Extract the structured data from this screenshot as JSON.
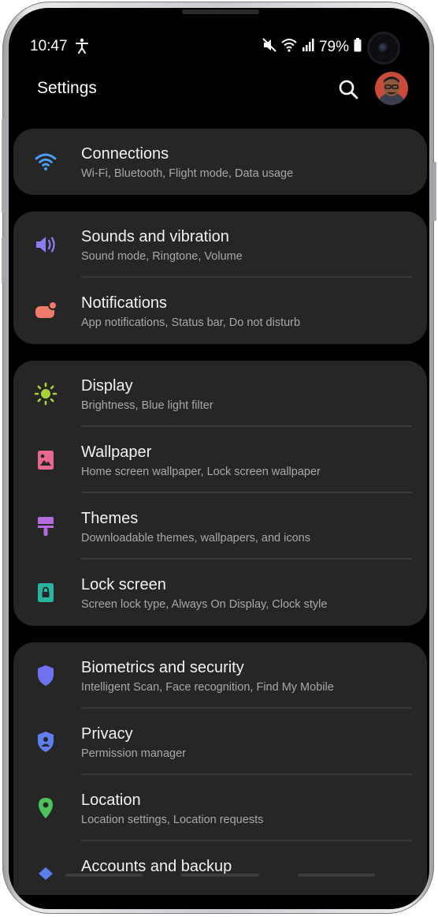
{
  "status_bar": {
    "time": "10:47",
    "battery": "79%",
    "icons": [
      "accessibility-icon",
      "mute-icon",
      "wifi-icon",
      "signal-icon",
      "battery-icon"
    ]
  },
  "header": {
    "title": "Settings",
    "search_icon": "search-icon",
    "avatar": "profile-avatar"
  },
  "groups": [
    {
      "items": [
        {
          "label": "Connections",
          "sub": "Wi-Fi, Bluetooth, Flight mode, Data usage",
          "icon": "wifi-icon",
          "color": "#4a9ff5"
        }
      ]
    },
    {
      "items": [
        {
          "label": "Sounds and vibration",
          "sub": "Sound mode, Ringtone, Volume",
          "icon": "volume-icon",
          "color": "#8a7cf0"
        },
        {
          "label": "Notifications",
          "sub": "App notifications, Status bar, Do not disturb",
          "icon": "notification-icon",
          "color": "#f27a6a"
        }
      ]
    },
    {
      "items": [
        {
          "label": "Display",
          "sub": "Brightness, Blue light filter",
          "icon": "brightness-icon",
          "color": "#a6d23a"
        },
        {
          "label": "Wallpaper",
          "sub": "Home screen wallpaper, Lock screen wallpaper",
          "icon": "wallpaper-icon",
          "color": "#e8698f"
        },
        {
          "label": "Themes",
          "sub": "Downloadable themes, wallpapers, and icons",
          "icon": "brush-icon",
          "color": "#b46be0"
        },
        {
          "label": "Lock screen",
          "sub": "Screen lock type, Always On Display, Clock style",
          "icon": "lock-icon",
          "color": "#28b49e"
        }
      ]
    },
    {
      "items": [
        {
          "label": "Biometrics and security",
          "sub": "Intelligent Scan, Face recognition, Find My Mobile",
          "icon": "shield-icon",
          "color": "#6f72f0"
        },
        {
          "label": "Privacy",
          "sub": "Permission manager",
          "icon": "privacy-icon",
          "color": "#5f7ff0"
        },
        {
          "label": "Location",
          "sub": "Location settings, Location requests",
          "icon": "location-pin-icon",
          "color": "#4cc25a"
        },
        {
          "label": "Accounts and backup",
          "sub": "",
          "icon": "account-icon",
          "color": "#5b7ff0"
        }
      ]
    }
  ]
}
